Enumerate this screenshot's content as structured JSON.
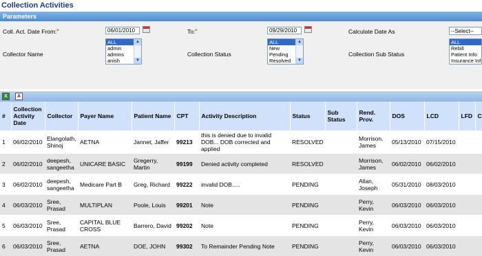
{
  "title": "Collection Activities",
  "params_header": "Parameters",
  "params": {
    "date_from_label": "Coll. Act. Date From:",
    "date_from": "06/01/2010",
    "to_label": "To:",
    "to_date": "09/29/2010",
    "calc_label": "Calculate Date As",
    "calc_value": "--Select--",
    "collector_label": "Collector Name",
    "collectors": [
      "ALL",
      "admin",
      "admins",
      "anish"
    ],
    "status_label": "Collection Status",
    "statuses": [
      "ALL",
      "New",
      "Pending",
      "Resolved"
    ],
    "substatus_label": "Collection Sub Status",
    "substatuses": [
      "ALL",
      "Rebill",
      "Patient Info",
      "Insurance Inf"
    ]
  },
  "toolbar": {
    "excel_icon": "excel-export-icon",
    "pdf_icon": "pdf-export-icon"
  },
  "columns": [
    "#",
    "Collection Activity Date",
    "Collector",
    "Payer Name",
    "Patient Name",
    "CPT",
    "Activity Description",
    "Status",
    "Sub Status",
    "Rend. Prov.",
    "DOS",
    "LCD",
    "LFD",
    "C"
  ],
  "rows": [
    [
      "1",
      "06/02/2010",
      "Elangolath, Shinoj",
      "AETNA",
      "Jannet, Jaffer",
      "99213",
      "this is denied due to invalid DOB... DOB corrected and applied",
      "RESOLVED",
      "",
      "Morrison, James",
      "05/13/2010",
      "07/15/2010",
      "",
      ""
    ],
    [
      "2",
      "06/02/2010",
      "deepesh, sangeetha",
      "UNICARE BASIC",
      "Gregerry, Martin",
      "99199",
      "Denied activity completed",
      "RESOLVED",
      "",
      "Morrison, James",
      "06/02/2010",
      "06/02/2010",
      "",
      ""
    ],
    [
      "3",
      "06/02/2010",
      "deepesh, sangeetha",
      "Medicare Part B",
      "Greg, Richard",
      "99222",
      "invalid DOB.....",
      "PENDING",
      "",
      "Allan, Joseph",
      "05/31/2010",
      "08/03/2010",
      "",
      ""
    ],
    [
      "4",
      "06/03/2010",
      "Sree, Prasad",
      "MULTIPLAN",
      "Poole, Louis",
      "99201",
      "Note",
      "PENDING",
      "",
      "Perry, Kevin",
      "06/03/2010",
      "06/03/2010",
      "",
      ""
    ],
    [
      "5",
      "06/03/2010",
      "Sree, Prasad",
      "CAPITAL BLUE CROSS",
      "Barrero, David",
      "99202",
      "Note",
      "PENDING",
      "",
      "Perry, Kevin",
      "06/03/2010",
      "06/03/2010",
      "",
      ""
    ],
    [
      "6",
      "06/03/2010",
      "Sree, Prasad",
      "AETNA",
      "DOE, JOHN",
      "99302",
      "To Remainder Pending Note",
      "PENDING",
      "",
      "Perry, Kevin",
      "06/03/2010",
      "06/03/2010",
      "",
      ""
    ]
  ]
}
